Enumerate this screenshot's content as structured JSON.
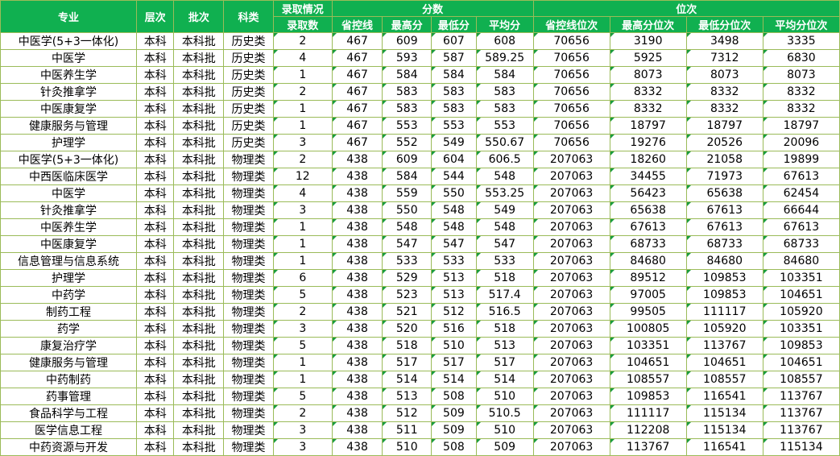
{
  "headers": {
    "major": "专业",
    "level": "层次",
    "batch": "批次",
    "category": "科类",
    "admission_top": "录取情况",
    "admission_count": "录取数",
    "score_group": "分数",
    "control_line": "省控线",
    "max_score": "最高分",
    "min_score": "最低分",
    "avg_score": "平均分",
    "rank_group": "位次",
    "control_rank": "省控线位次",
    "max_rank": "最高分位次",
    "min_rank": "最低分位次",
    "avg_rank": "平均分位次"
  },
  "rows": [
    [
      "中医学(5+3一体化)",
      "本科",
      "本科批",
      "历史类",
      "2",
      "467",
      "609",
      "607",
      "608",
      "70656",
      "3190",
      "3498",
      "3335"
    ],
    [
      "中医学",
      "本科",
      "本科批",
      "历史类",
      "4",
      "467",
      "593",
      "587",
      "589.25",
      "70656",
      "5925",
      "7312",
      "6830"
    ],
    [
      "中医养生学",
      "本科",
      "本科批",
      "历史类",
      "1",
      "467",
      "584",
      "584",
      "584",
      "70656",
      "8073",
      "8073",
      "8073"
    ],
    [
      "针灸推拿学",
      "本科",
      "本科批",
      "历史类",
      "2",
      "467",
      "583",
      "583",
      "583",
      "70656",
      "8332",
      "8332",
      "8332"
    ],
    [
      "中医康复学",
      "本科",
      "本科批",
      "历史类",
      "1",
      "467",
      "583",
      "583",
      "583",
      "70656",
      "8332",
      "8332",
      "8332"
    ],
    [
      "健康服务与管理",
      "本科",
      "本科批",
      "历史类",
      "1",
      "467",
      "553",
      "553",
      "553",
      "70656",
      "18797",
      "18797",
      "18797"
    ],
    [
      "护理学",
      "本科",
      "本科批",
      "历史类",
      "3",
      "467",
      "552",
      "549",
      "550.67",
      "70656",
      "19276",
      "20526",
      "20096"
    ],
    [
      "中医学(5+3一体化)",
      "本科",
      "本科批",
      "物理类",
      "2",
      "438",
      "609",
      "604",
      "606.5",
      "207063",
      "18260",
      "21058",
      "19899"
    ],
    [
      "中西医临床医学",
      "本科",
      "本科批",
      "物理类",
      "12",
      "438",
      "584",
      "544",
      "548",
      "207063",
      "34455",
      "71973",
      "67613"
    ],
    [
      "中医学",
      "本科",
      "本科批",
      "物理类",
      "4",
      "438",
      "559",
      "550",
      "553.25",
      "207063",
      "56423",
      "65638",
      "62454"
    ],
    [
      "针灸推拿学",
      "本科",
      "本科批",
      "物理类",
      "3",
      "438",
      "550",
      "548",
      "549",
      "207063",
      "65638",
      "67613",
      "66644"
    ],
    [
      "中医养生学",
      "本科",
      "本科批",
      "物理类",
      "1",
      "438",
      "548",
      "548",
      "548",
      "207063",
      "67613",
      "67613",
      "67613"
    ],
    [
      "中医康复学",
      "本科",
      "本科批",
      "物理类",
      "1",
      "438",
      "547",
      "547",
      "547",
      "207063",
      "68733",
      "68733",
      "68733"
    ],
    [
      "信息管理与信息系统",
      "本科",
      "本科批",
      "物理类",
      "1",
      "438",
      "533",
      "533",
      "533",
      "207063",
      "84680",
      "84680",
      "84680"
    ],
    [
      "护理学",
      "本科",
      "本科批",
      "物理类",
      "6",
      "438",
      "529",
      "513",
      "518",
      "207063",
      "89512",
      "109853",
      "103351"
    ],
    [
      "中药学",
      "本科",
      "本科批",
      "物理类",
      "5",
      "438",
      "523",
      "513",
      "517.4",
      "207063",
      "97005",
      "109853",
      "104651"
    ],
    [
      "制药工程",
      "本科",
      "本科批",
      "物理类",
      "2",
      "438",
      "521",
      "512",
      "516.5",
      "207063",
      "99505",
      "111117",
      "105920"
    ],
    [
      "药学",
      "本科",
      "本科批",
      "物理类",
      "3",
      "438",
      "520",
      "516",
      "518",
      "207063",
      "100805",
      "105920",
      "103351"
    ],
    [
      "康复治疗学",
      "本科",
      "本科批",
      "物理类",
      "5",
      "438",
      "518",
      "510",
      "513",
      "207063",
      "103351",
      "113767",
      "109853"
    ],
    [
      "健康服务与管理",
      "本科",
      "本科批",
      "物理类",
      "1",
      "438",
      "517",
      "517",
      "517",
      "207063",
      "104651",
      "104651",
      "104651"
    ],
    [
      "中药制药",
      "本科",
      "本科批",
      "物理类",
      "1",
      "438",
      "514",
      "514",
      "514",
      "207063",
      "108557",
      "108557",
      "108557"
    ],
    [
      "药事管理",
      "本科",
      "本科批",
      "物理类",
      "5",
      "438",
      "513",
      "508",
      "510",
      "207063",
      "109853",
      "116541",
      "113767"
    ],
    [
      "食品科学与工程",
      "本科",
      "本科批",
      "物理类",
      "2",
      "438",
      "512",
      "509",
      "510.5",
      "207063",
      "111117",
      "115134",
      "113767"
    ],
    [
      "医学信息工程",
      "本科",
      "本科批",
      "物理类",
      "3",
      "438",
      "511",
      "509",
      "510",
      "207063",
      "112208",
      "115134",
      "113767"
    ],
    [
      "中药资源与开发",
      "本科",
      "本科批",
      "物理类",
      "3",
      "438",
      "510",
      "508",
      "509",
      "207063",
      "113767",
      "116541",
      "115134"
    ]
  ]
}
